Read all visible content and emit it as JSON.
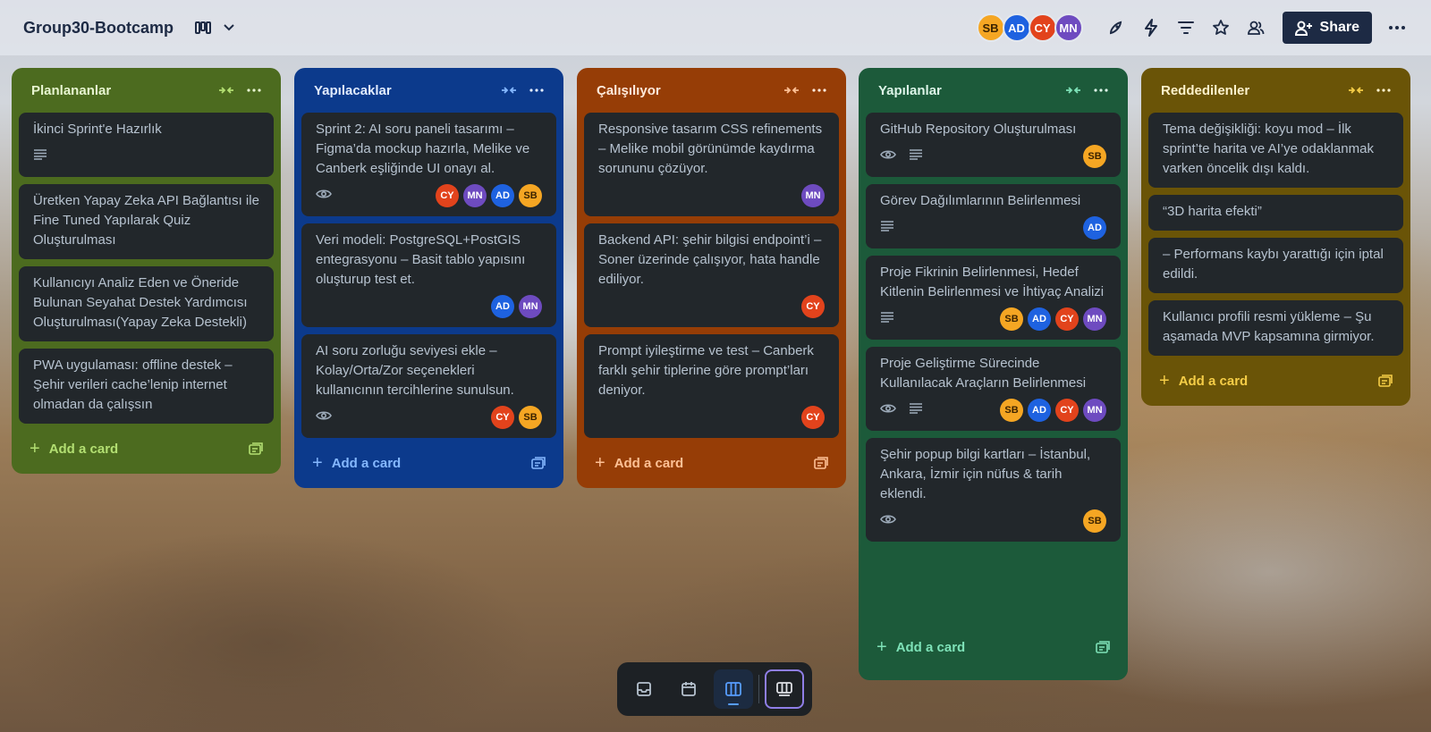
{
  "board": {
    "title": "Group30-Bootcamp"
  },
  "header": {
    "members": [
      {
        "initials": "SB",
        "color": "sb"
      },
      {
        "initials": "AD",
        "color": "ad"
      },
      {
        "initials": "CY",
        "color": "cy"
      },
      {
        "initials": "MN",
        "color": "mn"
      }
    ],
    "share_label": "Share"
  },
  "lists": [
    {
      "title": "Planlananlar",
      "color": "#4c6b1f",
      "title_color": "#e7f5d0",
      "add_label": "Add a card",
      "cards": [
        {
          "text": "İkinci Sprint'e Hazırlık",
          "description": true,
          "watch": false,
          "members": []
        },
        {
          "text": "Üretken Yapay Zeka API Bağlantısı ile Fine Tuned Yapılarak Quiz Oluşturulması",
          "description": false,
          "watch": false,
          "members": []
        },
        {
          "text": "Kullanıcıyı Analiz Eden ve Öneride Bulunan Seyahat Destek Yardımcısı Oluşturulması(Yapay Zeka Destekli)",
          "description": false,
          "watch": false,
          "members": []
        },
        {
          "text": "PWA uygulaması: offline destek – Şehir verileri cache’lenip internet olmadan da çalışsın",
          "description": false,
          "watch": false,
          "members": []
        }
      ]
    },
    {
      "title": "Yapılacaklar",
      "color": "#0c3a8c",
      "title_color": "#e2ecff",
      "add_label": "Add a card",
      "cards": [
        {
          "text": "Sprint 2: AI soru paneli tasarımı – Figma’da mockup hazırla, Melike ve Canberk eşliğinde UI onayı al.",
          "description": false,
          "watch": true,
          "members": [
            "CY",
            "MN",
            "AD",
            "SB"
          ]
        },
        {
          "text": "Veri modeli: PostgreSQL+PostGIS entegrasyonu – Basit tablo yapısını oluşturup test et.",
          "description": false,
          "watch": false,
          "members": [
            "AD",
            "MN"
          ]
        },
        {
          "text": "AI soru zorluğu seviyesi ekle – Kolay/Orta/Zor seçenekleri kullanıcının tercihlerine sunulsun.",
          "description": false,
          "watch": true,
          "members": [
            "CY",
            "SB"
          ]
        }
      ]
    },
    {
      "title": "Çalışılıyor",
      "color": "#963d06",
      "title_color": "#ffe9da",
      "add_label": "Add a card",
      "cards": [
        {
          "text": "Responsive tasarım CSS refinements – Melike mobil görünümde kaydırma sorununu çözüyor.",
          "description": false,
          "watch": false,
          "members": [
            "MN"
          ]
        },
        {
          "text": "Backend API: şehir bilgisi endpoint’i – Soner üzerinde çalışıyor, hata handle ediliyor.",
          "description": false,
          "watch": false,
          "members": [
            "CY"
          ]
        },
        {
          "text": "Prompt iyileştirme ve test – Canberk farklı şehir tiplerine göre prompt’ları deniyor.",
          "description": false,
          "watch": false,
          "members": [
            "CY"
          ]
        }
      ]
    },
    {
      "title": "Yapılanlar",
      "color": "#1c5a3a",
      "title_color": "#dcf5e8",
      "add_label": "Add a card",
      "cards": [
        {
          "text": "GitHub Repository Oluşturulması",
          "description": true,
          "watch": true,
          "members": [
            "SB"
          ]
        },
        {
          "text": "Görev Dağılımlarının Belirlenmesi",
          "description": true,
          "watch": false,
          "members": [
            "AD"
          ]
        },
        {
          "text": "Proje Fikrinin Belirlenmesi, Hedef Kitlenin Belirlenmesi ve İhtiyaç Analizi",
          "description": true,
          "watch": false,
          "members": [
            "SB",
            "AD",
            "CY",
            "MN"
          ]
        },
        {
          "text": "Proje Geliştirme Sürecinde Kullanılacak Araçların Belirlenmesi",
          "description": true,
          "watch": true,
          "members": [
            "SB",
            "AD",
            "CY",
            "MN"
          ]
        },
        {
          "text": "Şehir popup bilgi kartları – İstanbul, Ankara, İzmir için nüfus & tarih eklendi.",
          "description": false,
          "watch": true,
          "members": [
            "SB"
          ]
        }
      ]
    },
    {
      "title": "Reddedilenler",
      "color": "#6a5407",
      "title_color": "#fff3cc",
      "add_label": "Add a card",
      "cards": [
        {
          "text": "Tema değişikliği: koyu mod – İlk sprint’te harita ve AI’ye odaklanmak varken öncelik dışı kaldı.",
          "description": false,
          "watch": false,
          "members": []
        },
        {
          "text": "“3D harita efekti”",
          "description": false,
          "watch": false,
          "members": []
        },
        {
          "text": "– Performans kaybı yarattığı için iptal edildi.",
          "description": false,
          "watch": false,
          "members": []
        },
        {
          "text": "Kullanıcı profili resmi yükleme – Şu aşamada MVP kapsamına girmiyor.",
          "description": false,
          "watch": false,
          "members": []
        }
      ]
    }
  ],
  "colors": {
    "card_bg": "#22272b",
    "card_text": "#b6c2cf",
    "header_text": "#1d2a44",
    "add_green": "#b3df72",
    "add_blue": "#85b8ff",
    "add_orange": "#fec195",
    "add_teal": "#7ee2b8",
    "add_yellow": "#f5cd47"
  }
}
